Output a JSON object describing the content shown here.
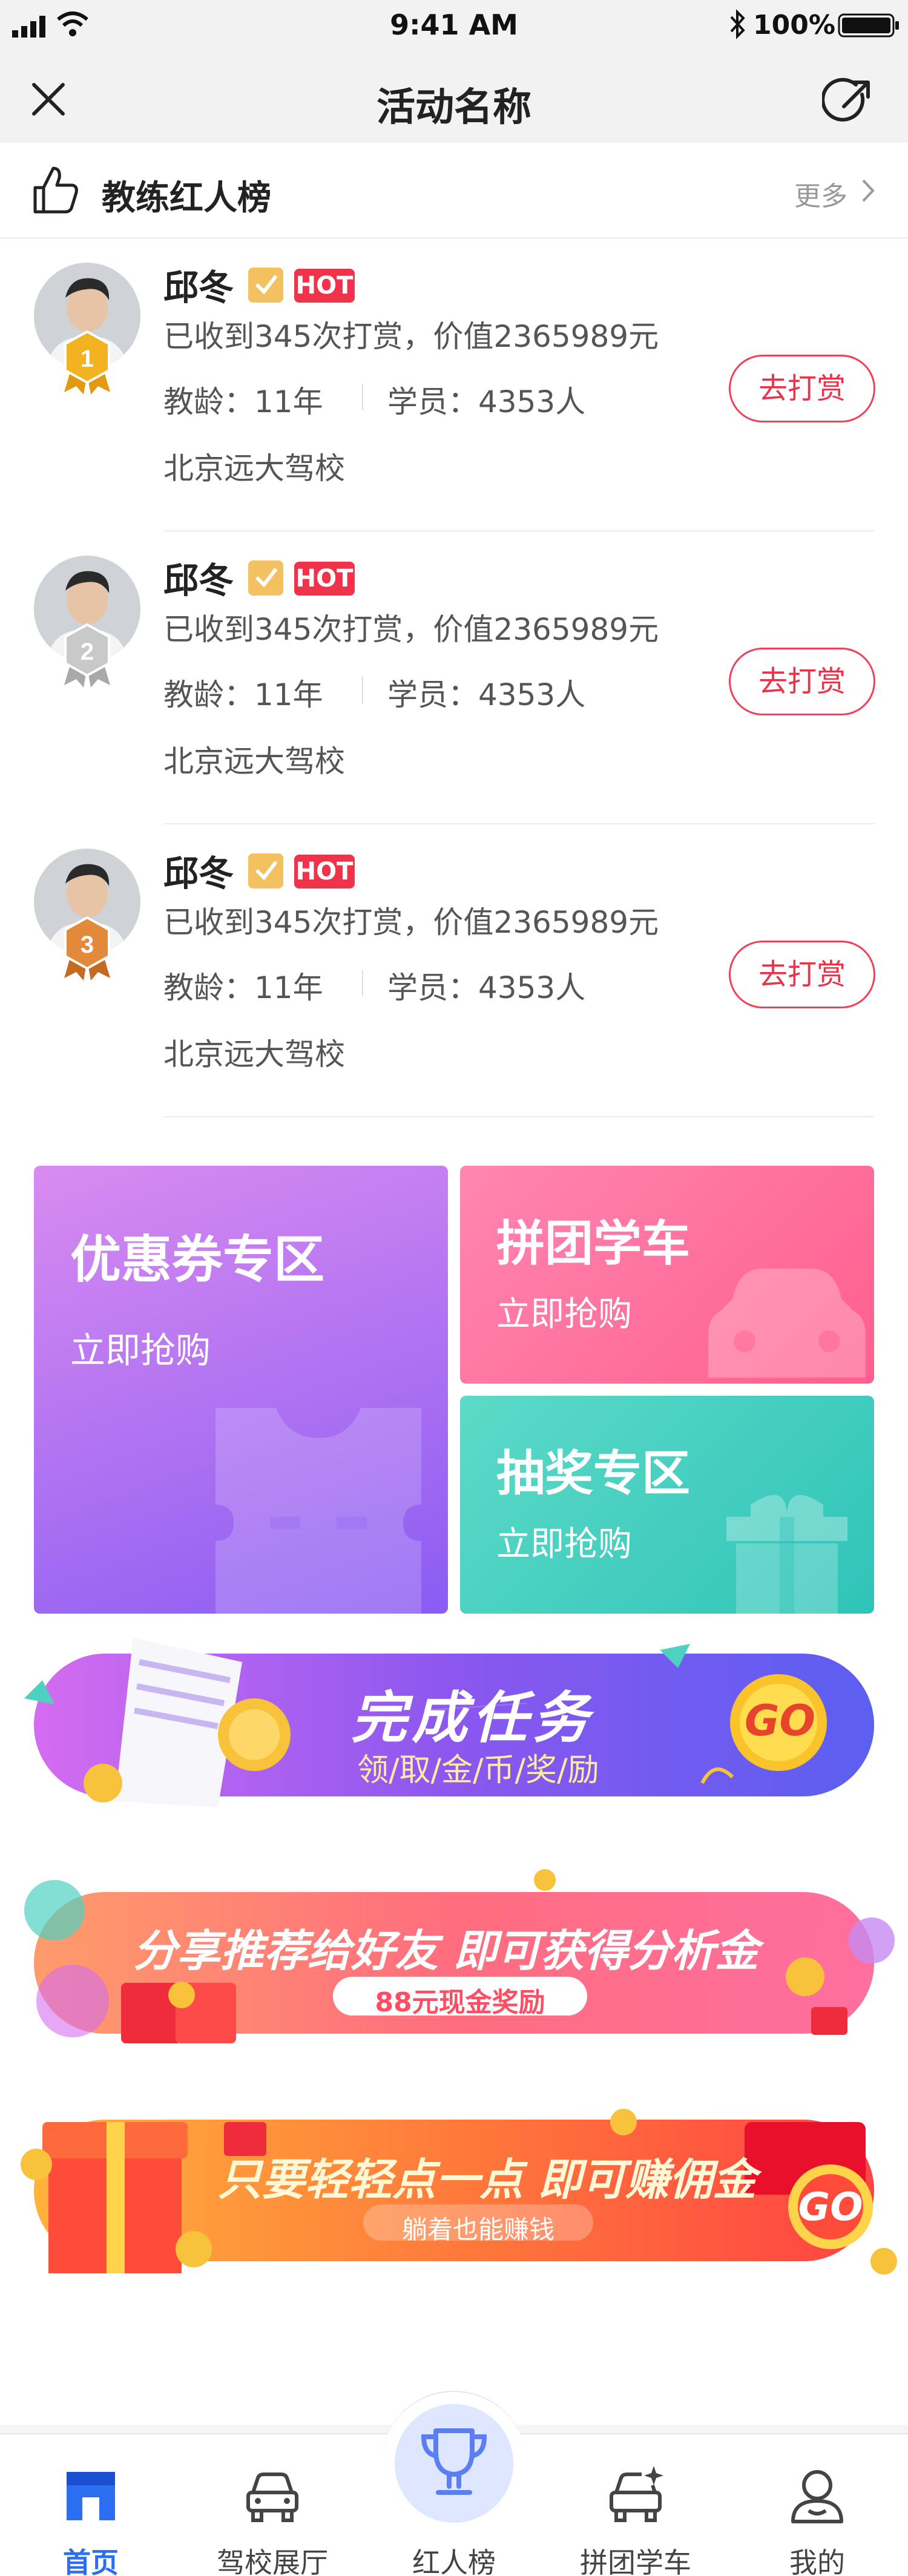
{
  "status_bar": {
    "time": "9:41 AM",
    "battery": "100%"
  },
  "nav": {
    "title": "活动名称"
  },
  "leaderboard": {
    "title": "教练红人榜",
    "more": "更多",
    "coaches": [
      {
        "rank": "1",
        "name": "邱冬",
        "hot": "HOT",
        "tips": "已收到345次打赏，价值2365989元",
        "years": "教龄：11年",
        "students": "学员：4353人",
        "school": "北京远大驾校",
        "tip_button": "去打赏",
        "medal_color": "#f3b21f"
      },
      {
        "rank": "2",
        "name": "邱冬",
        "hot": "HOT",
        "tips": "已收到345次打赏，价值2365989元",
        "years": "教龄：11年",
        "students": "学员：4353人",
        "school": "北京远大驾校",
        "tip_button": "去打赏",
        "medal_color": "#c9c9c9"
      },
      {
        "rank": "3",
        "name": "邱冬",
        "hot": "HOT",
        "tips": "已收到345次打赏，价值2365989元",
        "years": "教龄：11年",
        "students": "学员：4353人",
        "school": "北京远大驾校",
        "tip_button": "去打赏",
        "medal_color": "#e38a3a"
      }
    ]
  },
  "promo": {
    "coupon": {
      "title": "优惠券专区",
      "subtitle": "立即抢购"
    },
    "group": {
      "title": "拼团学车",
      "subtitle": "立即抢购"
    },
    "lottery": {
      "title": "抽奖专区",
      "subtitle": "立即抢购"
    }
  },
  "banners": {
    "task": {
      "title": "完成任务",
      "subtitle": "领/取/金/币/奖/励",
      "go": "GO"
    },
    "share": {
      "title": "分享推荐给好友  即可获得分析金",
      "sub": "88元现金奖励"
    },
    "earn": {
      "title": "只要轻轻点一点  即可赚佣金",
      "sub": "躺着也能赚钱",
      "go": "GO"
    }
  },
  "tabbar": {
    "items": [
      {
        "label": "首页",
        "icon": "home-icon",
        "active": true
      },
      {
        "label": "驾校展厅",
        "icon": "car-icon"
      },
      {
        "label": "红人榜",
        "icon": "trophy-icon"
      },
      {
        "label": "拼团学车",
        "icon": "sparkle-car-icon"
      },
      {
        "label": "我的",
        "icon": "user-icon"
      }
    ]
  },
  "colors": {
    "accent": "#2b6ff0",
    "hot": "#f0334a",
    "tip": "#f1405a"
  }
}
